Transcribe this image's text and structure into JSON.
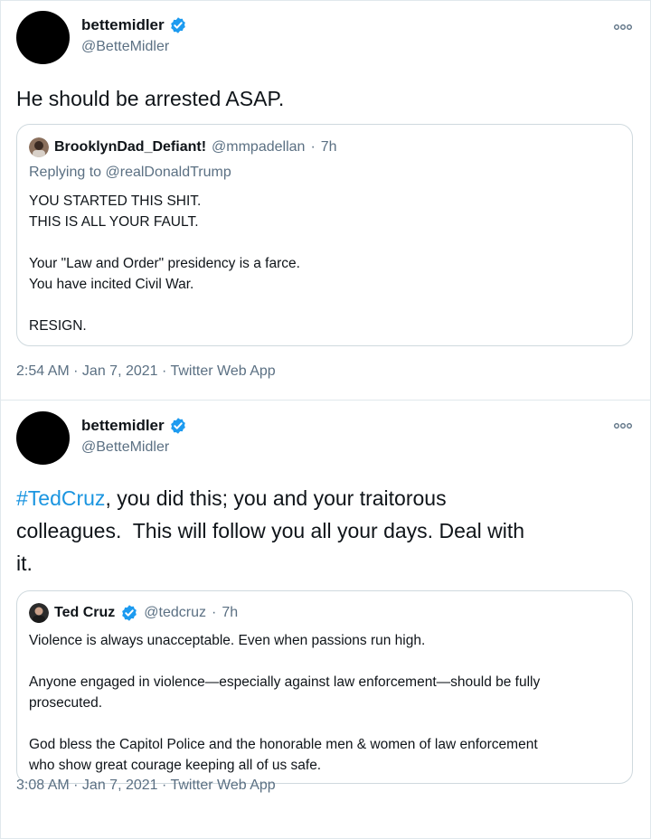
{
  "tweets": [
    {
      "author": {
        "display_name": "bettemidler",
        "handle": "@BetteMidler",
        "verified": true
      },
      "text": "He should be arrested ASAP.",
      "quoted": {
        "author": {
          "display_name": "BrooklynDad_Defiant!",
          "handle": "@mmpadellan",
          "time": "7h"
        },
        "reply_prefix": "Replying to",
        "reply_to": "@realDonaldTrump",
        "lines": [
          "YOU STARTED THIS SHIT.",
          "THIS IS ALL YOUR FAULT.",
          "",
          "Your \"Law and Order\" presidency is a farce.",
          "You have incited Civil War.",
          "",
          "RESIGN."
        ]
      },
      "meta": "2:54 AM · Jan 7, 2021 · Twitter Web App"
    },
    {
      "author": {
        "display_name": "bettemidler",
        "handle": "@BetteMidler",
        "verified": true
      },
      "hashtag": "#TedCruz",
      "text_rest": ", you did this; you and your traitorous\ncolleagues.  This will follow you all your days. Deal with\nit.",
      "quoted": {
        "author": {
          "display_name": "Ted Cruz",
          "handle": "@tedcruz",
          "time": "7h",
          "verified": true
        },
        "lines": [
          "Violence is always unacceptable. Even when passions run high.",
          "",
          "Anyone engaged in violence—especially against law enforcement—should be fully",
          "prosecuted.",
          "",
          "God bless the Capitol Police and the honorable men & women of law enforcement",
          "who show great courage keeping all of us safe."
        ]
      },
      "meta": "3:08 AM · Jan 7, 2021 · Twitter Web App"
    }
  ],
  "separator": " · ",
  "icons": {
    "verified": "verified-badge-icon",
    "more": "more-options-icon"
  },
  "colors": {
    "text": "#0f1419",
    "secondary": "#5b7083",
    "link": "#1b95e0",
    "verified": "#1d9bf0",
    "border": "#cfd9de"
  }
}
